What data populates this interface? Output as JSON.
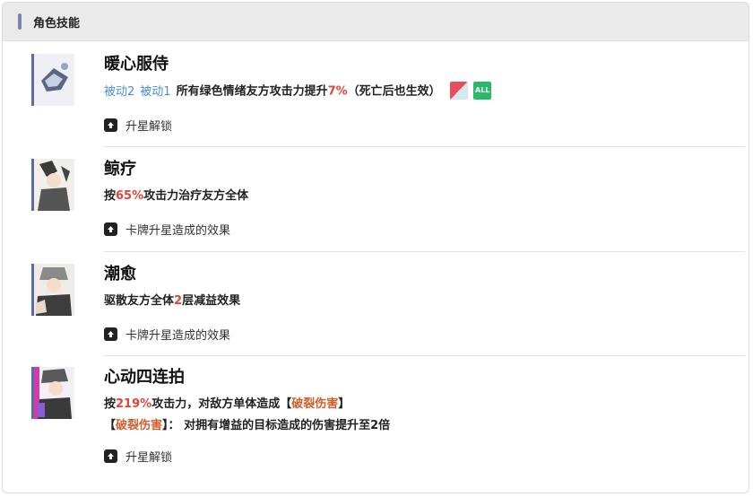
{
  "header": {
    "title": "角色技能"
  },
  "skills": [
    {
      "name": "暖心服侍",
      "tags": [
        "被动2",
        "被动1"
      ],
      "desc_pre": "所有绿色情绪友方攻击力提升",
      "desc_value": "7%",
      "desc_post": "（死亡后也生效）",
      "effect_icons": [
        "red-heart-icon",
        "all-target-icon"
      ],
      "all_label": "ALL",
      "upgrade": "升星解锁"
    },
    {
      "name": "鲸疗",
      "desc_pre": "按",
      "desc_value": "65%",
      "desc_post": "攻击力治疗友方全体",
      "upgrade": "卡牌升星造成的效果"
    },
    {
      "name": "潮愈",
      "desc_pre": "驱散友方全体",
      "desc_value": "2",
      "desc_post": "层减益效果",
      "upgrade": "卡牌升星造成的效果"
    },
    {
      "name": "心动四连拍",
      "desc_pre": "按",
      "desc_value": "219%",
      "desc_mid": "攻击力，对敌方单体造成",
      "desc_bracket_open": "【",
      "desc_keyword": "破裂伤害",
      "desc_bracket_close": "】",
      "line2_bracket_open": "【",
      "line2_keyword": "破裂伤害",
      "line2_bracket_close": "】",
      "line2_post": "：  对拥有增益的目标造成的伤害提升至",
      "line2_value": "2倍",
      "upgrade": "升星解锁"
    }
  ],
  "colors": {
    "accent_bar": "#7c86a8",
    "highlight_red": "#e0443a",
    "highlight_orange": "#d0602b",
    "link_blue": "#4a8cd6"
  }
}
